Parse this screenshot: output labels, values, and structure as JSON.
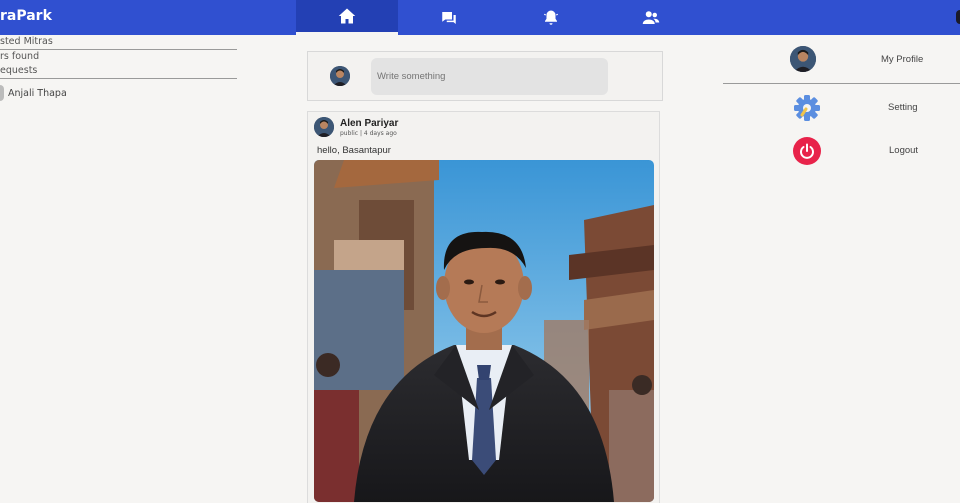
{
  "header": {
    "brand": "raPark",
    "nav_tabs": [
      {
        "name": "home",
        "icon": "home-icon",
        "active": true
      },
      {
        "name": "messages",
        "icon": "chat-icon",
        "active": false
      },
      {
        "name": "notifications",
        "icon": "bell-icon",
        "active": false
      },
      {
        "name": "friends",
        "icon": "users-icon",
        "active": false
      }
    ],
    "accent_color": "#3050d0"
  },
  "left_panel": {
    "rows": [
      "sted Mitras",
      "rs found",
      "equests"
    ],
    "friend_name": "Anjali Thapa"
  },
  "composer": {
    "placeholder": "Write something"
  },
  "post": {
    "author": "Alen Pariyar",
    "subtitle": "public | 4 days ago",
    "text": "hello, Basantapur"
  },
  "right_panel": {
    "items": [
      {
        "label": "My Profile",
        "icon": "avatar"
      },
      {
        "label": "Setting",
        "icon": "gear-icon"
      },
      {
        "label": "Logout",
        "icon": "power-icon"
      }
    ],
    "logout_color": "#e8234a",
    "gear_color": "#5b8ee0"
  }
}
